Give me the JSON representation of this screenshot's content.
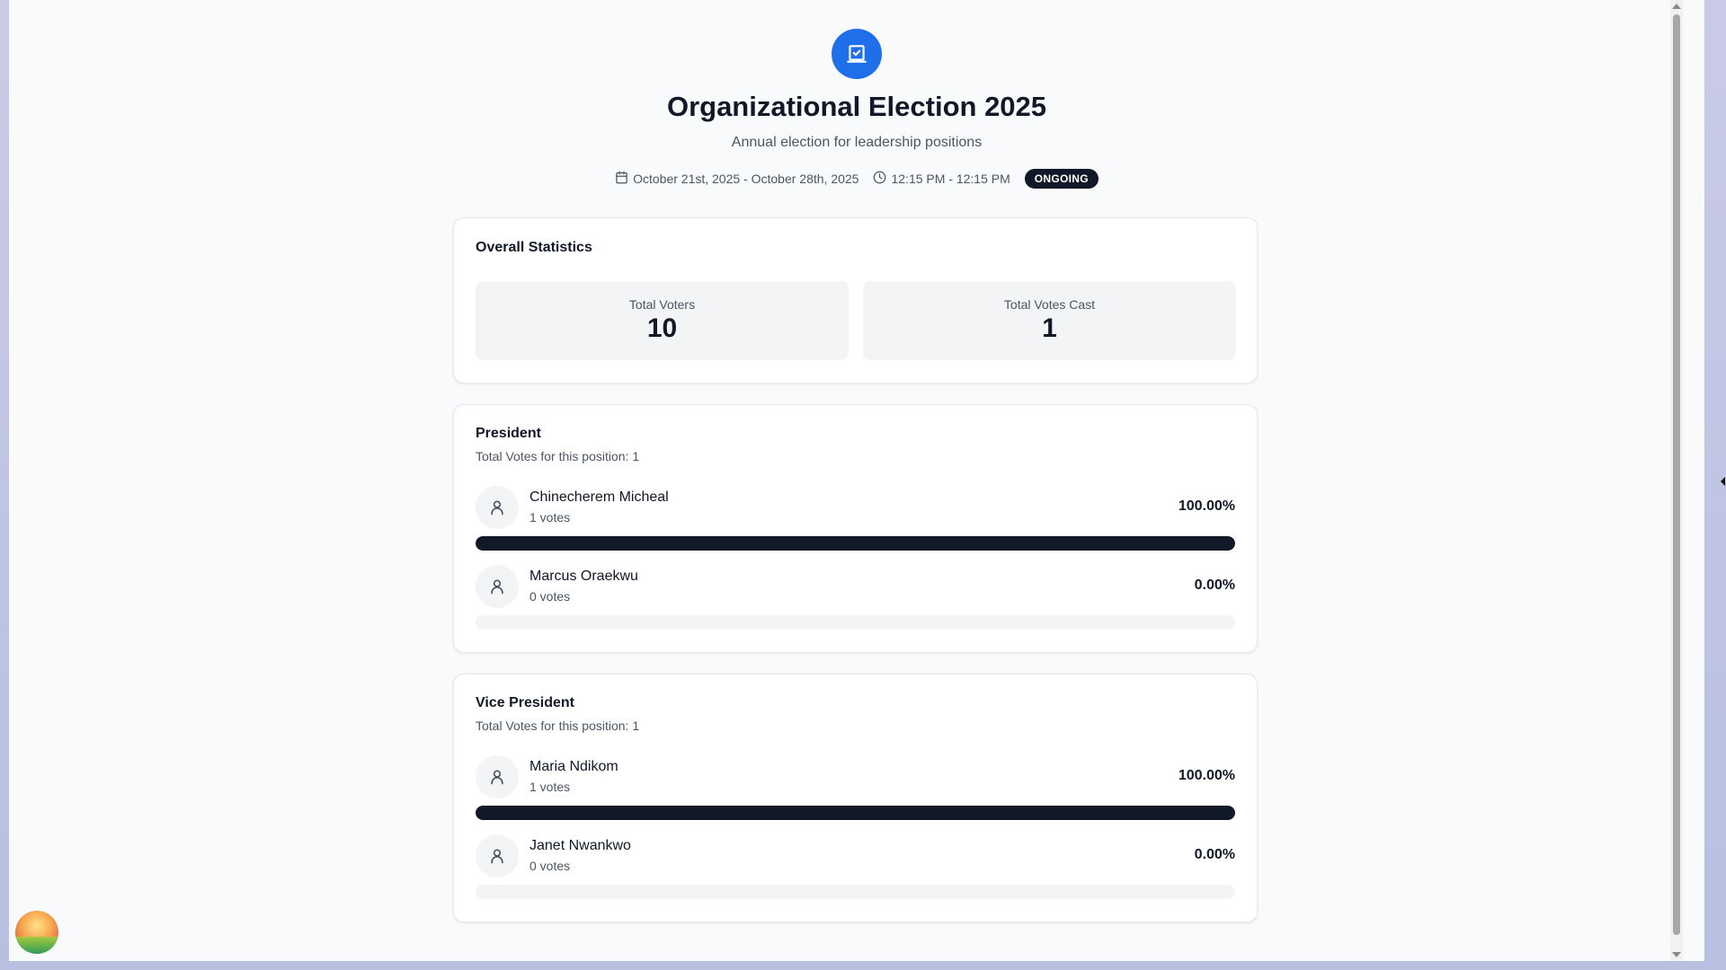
{
  "header": {
    "title": "Organizational Election 2025",
    "subtitle": "Annual election for leadership positions",
    "date_range": "October 21st, 2025 - October 28th, 2025",
    "time_range": "12:15 PM - 12:15 PM",
    "status": "ONGOING"
  },
  "stats": {
    "title": "Overall Statistics",
    "total_voters_label": "Total Voters",
    "total_voters_value": "10",
    "total_votes_label": "Total Votes Cast",
    "total_votes_value": "1"
  },
  "positions": [
    {
      "title": "President",
      "subtitle": "Total Votes for this position: 1",
      "candidates": [
        {
          "name": "Chinecherem Micheal",
          "votes": "1 votes",
          "percent": "100.00%",
          "share": 1.0
        },
        {
          "name": "Marcus Oraekwu",
          "votes": "0 votes",
          "percent": "0.00%",
          "share": 0.0
        }
      ]
    },
    {
      "title": "Vice President",
      "subtitle": "Total Votes for this position: 1",
      "candidates": [
        {
          "name": "Maria Ndikom",
          "votes": "1 votes",
          "percent": "100.00%",
          "share": 1.0
        },
        {
          "name": "Janet Nwankwo",
          "votes": "0 votes",
          "percent": "0.00%",
          "share": 0.0
        }
      ]
    }
  ],
  "colors": {
    "accent": "#1f6feb",
    "bar_fill": "#111827",
    "bar_track": "#f3f4f6"
  },
  "icons": {
    "logo": "ballot-box-icon",
    "calendar": "calendar-icon",
    "clock": "clock-icon",
    "candidate": "user-icon"
  }
}
